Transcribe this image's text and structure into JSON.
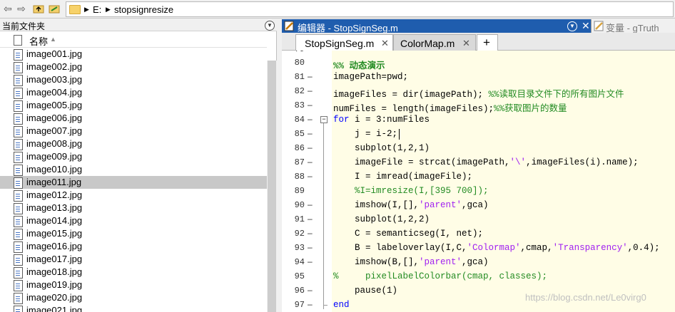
{
  "address": {
    "drive": "E:",
    "folder": "stopsignresize"
  },
  "left_pane": {
    "title": "当前文件夹",
    "column_name": "名称",
    "files": [
      "image001.jpg",
      "image002.jpg",
      "image003.jpg",
      "image004.jpg",
      "image005.jpg",
      "image006.jpg",
      "image007.jpg",
      "image008.jpg",
      "image009.jpg",
      "image010.jpg",
      "image011.jpg",
      "image012.jpg",
      "image013.jpg",
      "image014.jpg",
      "image015.jpg",
      "image016.jpg",
      "image017.jpg",
      "image018.jpg",
      "image019.jpg",
      "image020.jpg",
      "image021.jpg"
    ],
    "selected_index": 10
  },
  "editor": {
    "title": "编辑器 - StopSignSeg.m",
    "variables_tab": "变量 - gTruth",
    "tabs": [
      {
        "label": "StopSignSeg.m",
        "active": true
      },
      {
        "label": "ColorMap.m",
        "active": false
      }
    ],
    "add_tab": "+",
    "lines": [
      {
        "n": "80",
        "dash": "",
        "code": [
          {
            "t": "%% 动态演示",
            "c": "com"
          }
        ]
      },
      {
        "n": "81",
        "dash": "–",
        "code": [
          {
            "t": "imagePath=pwd;",
            "c": ""
          }
        ]
      },
      {
        "n": "82",
        "dash": "–",
        "code": [
          {
            "t": "imageFiles = dir(imagePath); ",
            "c": ""
          },
          {
            "t": "%%读取目录文件下的所有图片文件",
            "c": "com"
          }
        ]
      },
      {
        "n": "83",
        "dash": "–",
        "code": [
          {
            "t": "numFiles = length(imageFiles);",
            "c": ""
          },
          {
            "t": "%%获取图片的数量",
            "c": "com"
          }
        ]
      },
      {
        "n": "84",
        "dash": "–",
        "code": [
          {
            "t": "for",
            "c": "kw"
          },
          {
            "t": " i = 3:numFiles",
            "c": ""
          }
        ]
      },
      {
        "n": "85",
        "dash": "–",
        "code": [
          {
            "t": "    j = i-2; ",
            "c": ""
          }
        ]
      },
      {
        "n": "86",
        "dash": "–",
        "code": [
          {
            "t": "    subplot(1,2,1)",
            "c": ""
          }
        ]
      },
      {
        "n": "87",
        "dash": "–",
        "code": [
          {
            "t": "    imageFile = strcat(imagePath,",
            "c": ""
          },
          {
            "t": "'\\'",
            "c": "str"
          },
          {
            "t": ",imageFiles(i).name);",
            "c": ""
          }
        ]
      },
      {
        "n": "88",
        "dash": "–",
        "code": [
          {
            "t": "    I = imread(imageFile);",
            "c": ""
          }
        ]
      },
      {
        "n": "89",
        "dash": "",
        "code": [
          {
            "t": "    %I=imresize(I,[395 700]);",
            "c": "com"
          }
        ]
      },
      {
        "n": "90",
        "dash": "–",
        "code": [
          {
            "t": "    imshow(I,[],",
            "c": ""
          },
          {
            "t": "'parent'",
            "c": "str"
          },
          {
            "t": ",gca)",
            "c": ""
          }
        ]
      },
      {
        "n": "91",
        "dash": "–",
        "code": [
          {
            "t": "    subplot(1,2,2)",
            "c": ""
          }
        ]
      },
      {
        "n": "92",
        "dash": "–",
        "code": [
          {
            "t": "    C = semanticseg(I, net);",
            "c": ""
          }
        ]
      },
      {
        "n": "93",
        "dash": "–",
        "code": [
          {
            "t": "    B = labeloverlay(I,C,",
            "c": ""
          },
          {
            "t": "'Colormap'",
            "c": "str"
          },
          {
            "t": ",cmap,",
            "c": ""
          },
          {
            "t": "'Transparency'",
            "c": "str"
          },
          {
            "t": ",0.4);",
            "c": ""
          }
        ]
      },
      {
        "n": "94",
        "dash": "–",
        "code": [
          {
            "t": "    imshow(B,[],",
            "c": ""
          },
          {
            "t": "'parent'",
            "c": "str"
          },
          {
            "t": ",gca)",
            "c": ""
          }
        ]
      },
      {
        "n": "95",
        "dash": "",
        "code": [
          {
            "t": "%     pixelLabelColorbar(cmap, classes);",
            "c": "com"
          }
        ]
      },
      {
        "n": "96",
        "dash": "–",
        "code": [
          {
            "t": "    pause(1)",
            "c": ""
          }
        ]
      },
      {
        "n": "97",
        "dash": "–",
        "code": [
          {
            "t": "end",
            "c": "kw"
          }
        ]
      }
    ]
  },
  "watermark": "https://blog.csdn.net/Le0virg0"
}
